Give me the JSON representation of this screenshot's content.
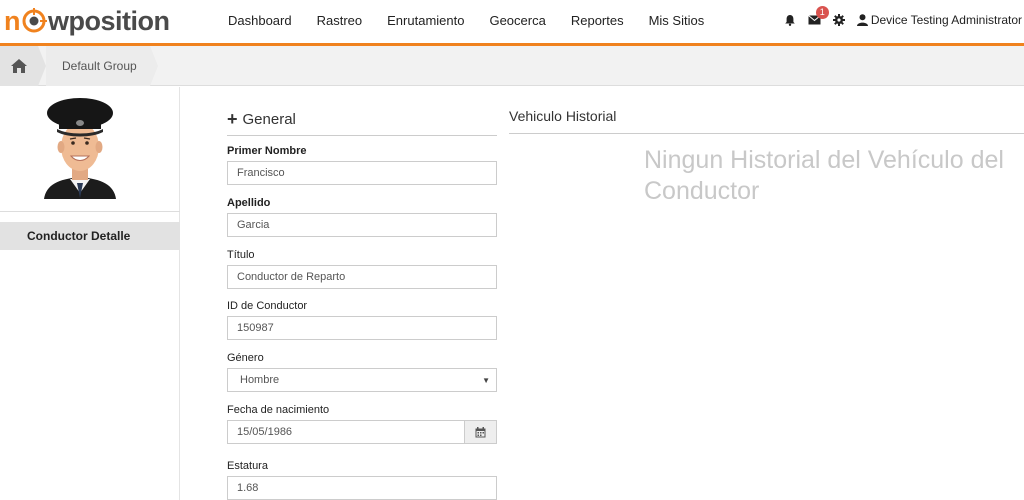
{
  "brand": {
    "logo_prefix": "n",
    "logo_suffix": "wposition",
    "accent": "#f0821e",
    "text_color": "#4a4a4a"
  },
  "nav": {
    "items": [
      "Dashboard",
      "Rastreo",
      "Enrutamiento",
      "Geocerca",
      "Reportes",
      "Mis Sitios"
    ]
  },
  "toolbar": {
    "bell_icon": "bell-icon",
    "mail_icon": "envelope-icon",
    "mail_badge": "1",
    "settings_icon": "gear-icon",
    "user_icon": "user-icon",
    "user_name": "Device Testing Administrator"
  },
  "breadcrumb": {
    "home_icon": "home-icon",
    "current": "Default Group"
  },
  "sidebar": {
    "items": [
      {
        "label": "Conductor Detalle",
        "active": true
      }
    ]
  },
  "form": {
    "section_title": "General",
    "fields": {
      "first_name": {
        "label": "Primer Nombre",
        "value": "Francisco"
      },
      "last_name": {
        "label": "Apellido",
        "value": "Garcia"
      },
      "title": {
        "label": "Título",
        "value": "Conductor de Reparto"
      },
      "driver_id": {
        "label": "ID de Conductor",
        "value": "150987"
      },
      "gender": {
        "label": "Género",
        "value": "Hombre"
      },
      "birthdate": {
        "label": "Fecha de nacimiento",
        "value": "15/05/1986",
        "icon": "calendar-icon"
      },
      "height": {
        "label": "Estatura",
        "value": "1.68"
      }
    }
  },
  "vehicle_history": {
    "title": "Vehiculo Historial",
    "empty_message": "Ningun Historial del Vehículo del Conductor"
  }
}
